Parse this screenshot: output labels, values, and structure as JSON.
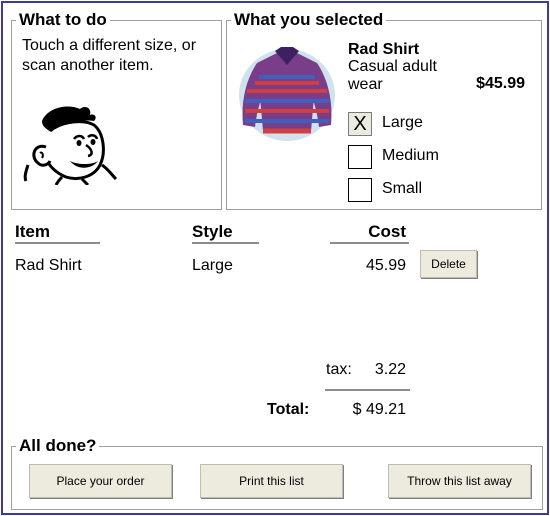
{
  "todo": {
    "title": "What to do",
    "instructions": "Touch a different size, or scan another item."
  },
  "selected": {
    "title": "What you selected",
    "product_name": "Rad Shirt",
    "description": "Casual adult wear",
    "price": "$45.99",
    "sizes": [
      {
        "label": "Large",
        "checked": true,
        "mark": "X"
      },
      {
        "label": "Medium",
        "checked": false,
        "mark": ""
      },
      {
        "label": "Small",
        "checked": false,
        "mark": ""
      }
    ]
  },
  "list": {
    "headers": {
      "item": "Item",
      "style": "Style",
      "cost": "Cost"
    },
    "rows": [
      {
        "item": "Rad Shirt",
        "style": "Large",
        "cost": "45.99",
        "delete_label": "Delete"
      }
    ],
    "tax_label": "tax:",
    "tax_value": "3.22",
    "total_label": "Total:",
    "total_value": "$ 49.21"
  },
  "done": {
    "title": "All done?",
    "order_label": "Place your order",
    "print_label": "Print this list",
    "throw_label": "Throw this list away"
  },
  "icons": [
    "cartoon-face-icon",
    "shirt-image"
  ]
}
